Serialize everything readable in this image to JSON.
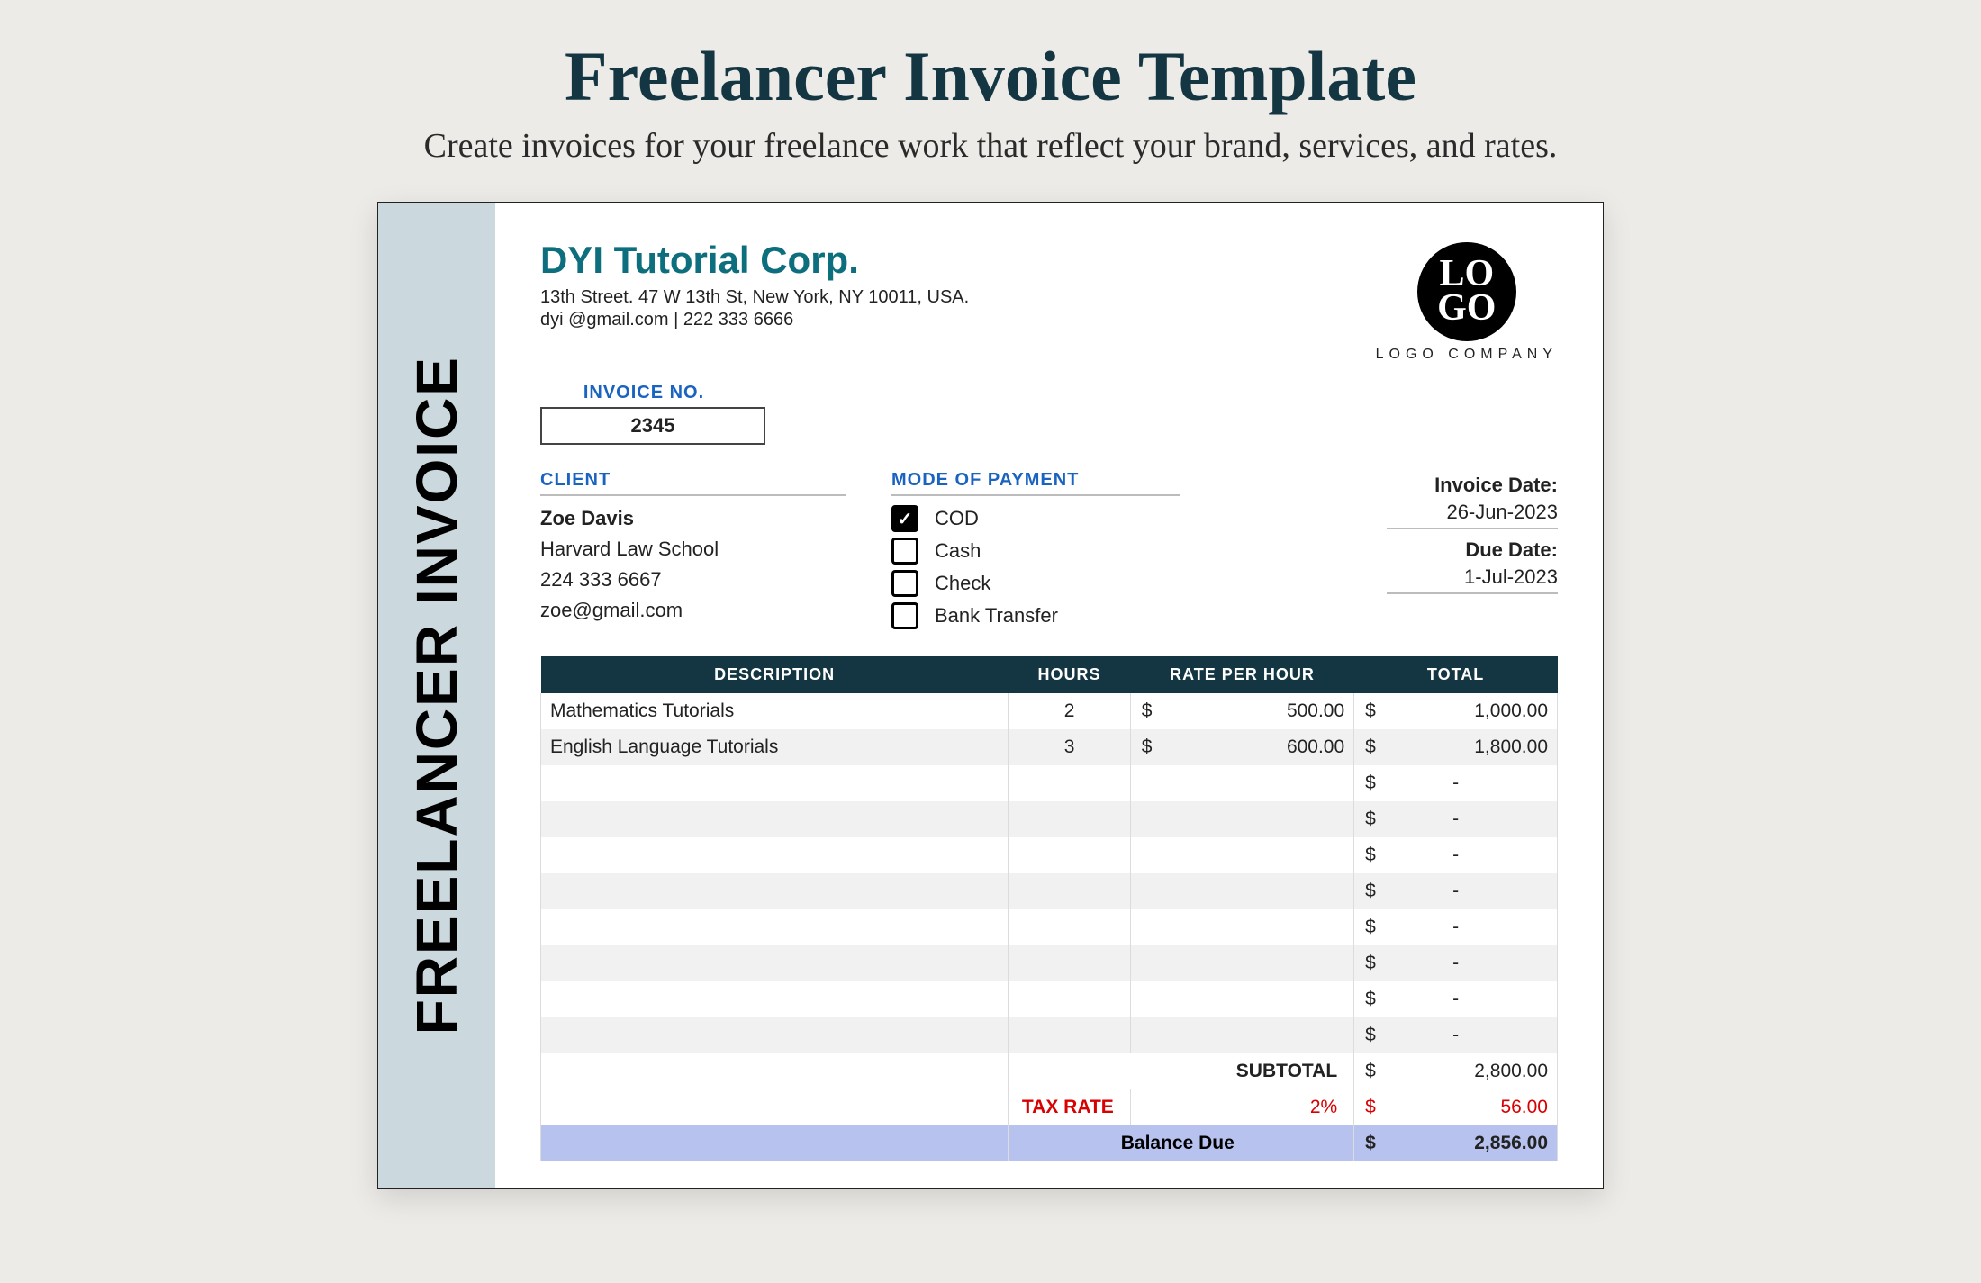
{
  "hero": {
    "title": "Freelancer Invoice Template",
    "subtitle": "Create invoices for your freelance work that reflect your brand, services, and rates."
  },
  "sideRail": "FREELANCER INVOICE",
  "company": {
    "name": "DYI Tutorial Corp.",
    "address": "13th Street. 47 W 13th St, New York, NY 10011, USA.",
    "contact": "dyi @gmail.com | 222 333 6666"
  },
  "logo": {
    "top": "LO",
    "bottom": "GO",
    "caption": "LOGO COMPANY"
  },
  "labels": {
    "invoiceNo": "INVOICE NO.",
    "client": "CLIENT",
    "payment": "MODE OF PAYMENT",
    "invoiceDate": "Invoice Date:",
    "dueDate": "Due Date:",
    "description": "DESCRIPTION",
    "hours": "HOURS",
    "rate": "RATE PER HOUR",
    "total": "TOTAL",
    "subtotal": "SUBTOTAL",
    "taxRate": "TAX RATE",
    "balanceDue": "Balance Due"
  },
  "invoice": {
    "number": "2345",
    "invoiceDate": "26-Jun-2023",
    "dueDate": "1-Jul-2023",
    "currency": "$"
  },
  "client": {
    "name": "Zoe Davis",
    "org": "Harvard Law School",
    "phone": "224 333 6667",
    "email": "zoe@gmail.com"
  },
  "payment": {
    "options": [
      {
        "label": "COD",
        "checked": true
      },
      {
        "label": "Cash",
        "checked": false
      },
      {
        "label": "Check",
        "checked": false
      },
      {
        "label": "Bank Transfer",
        "checked": false
      }
    ]
  },
  "lines": [
    {
      "desc": "Mathematics Tutorials",
      "hours": "2",
      "rate": "500.00",
      "total": "1,000.00"
    },
    {
      "desc": "English Language Tutorials",
      "hours": "3",
      "rate": "600.00",
      "total": "1,800.00"
    }
  ],
  "emptyRows": 8,
  "summary": {
    "subtotal": "2,800.00",
    "taxPct": "2%",
    "taxAmount": "56.00",
    "balance": "2,856.00"
  }
}
